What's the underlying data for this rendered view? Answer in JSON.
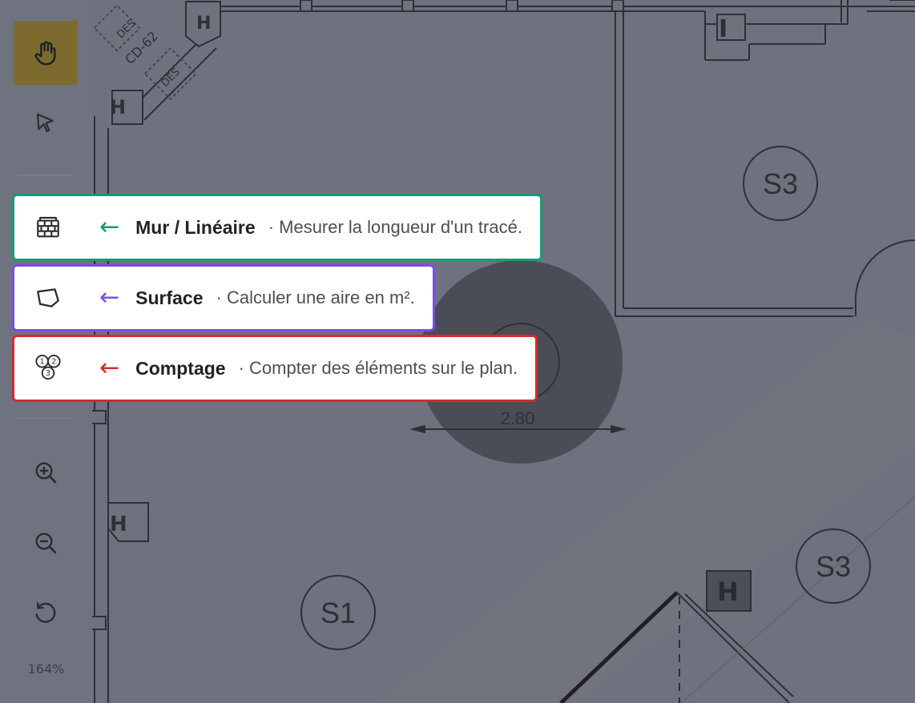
{
  "toolbar": {
    "tools": [
      {
        "name": "pan",
        "icon": "hand-icon",
        "active": true
      },
      {
        "name": "select",
        "icon": "cursor-arrow-icon",
        "active": false
      }
    ],
    "zoom_in_icon": "zoom-in-icon",
    "zoom_out_icon": "zoom-out-icon",
    "reset_icon": "reset-rotate-icon",
    "zoom_level": "164%",
    "active_color": "#7d6a2f"
  },
  "callouts": [
    {
      "icon": "brick-wall-icon",
      "arrow": "←",
      "title": "Mur / Linéaire",
      "description": "· Mesurer la longueur d'un tracé.",
      "color": "#1a9a72"
    },
    {
      "icon": "polygon-icon",
      "arrow": "←",
      "title": "Surface",
      "description": "· Calculer une aire en m².",
      "color": "#7b4ee0"
    },
    {
      "icon": "count-circles-icon",
      "arrow": "←",
      "title": "Comptage",
      "description": "· Compter des éléments sur le plan.",
      "color": "#d12c2c"
    }
  ],
  "plan": {
    "room_labels": [
      "S3",
      "S3",
      "S1"
    ],
    "dimension": "2.80",
    "tags": [
      "DES",
      "CD-62",
      "DES"
    ],
    "markers": [
      "H",
      "H",
      "H",
      "H"
    ]
  }
}
